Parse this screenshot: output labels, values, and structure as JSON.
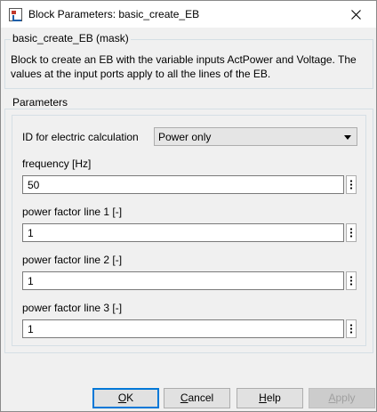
{
  "window": {
    "title": "Block Parameters: basic_create_EB"
  },
  "mask_group": {
    "legend": "basic_create_EB (mask)",
    "description": "Block to create an EB with the variable inputs ActPower and Voltage. The values at the input ports apply to all the lines of the EB."
  },
  "parameters": {
    "legend": "Parameters",
    "id_calc": {
      "label": "ID for electric calculation",
      "selected": "Power only"
    },
    "fields": [
      {
        "label": "frequency [Hz]",
        "value": "50"
      },
      {
        "label": "power factor line 1 [-]",
        "value": "1"
      },
      {
        "label": "power factor line 2 [-]",
        "value": "1"
      },
      {
        "label": "power factor line 3 [-]",
        "value": "1"
      }
    ]
  },
  "buttons": {
    "ok": {
      "mnemonic": "O",
      "rest": "K"
    },
    "cancel": {
      "mnemonic": "C",
      "rest": "ancel"
    },
    "help": {
      "mnemonic": "H",
      "rest": "elp"
    },
    "apply": {
      "mnemonic": "A",
      "rest": "pply"
    }
  },
  "icons": {
    "app": "block-parameters-icon",
    "close": "close-icon",
    "more": "more-vertical-icon",
    "dropdown": "chevron-down-icon"
  }
}
